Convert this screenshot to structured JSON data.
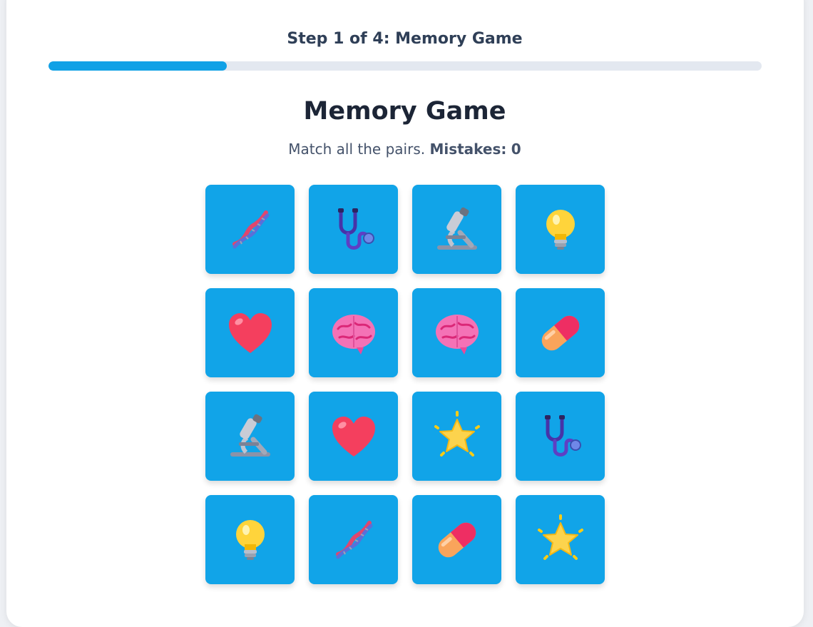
{
  "progress": {
    "label": "Step 1 of 4: Memory Game",
    "fraction": 0.25
  },
  "game": {
    "title": "Memory Game",
    "instruction": "Match all the pairs.",
    "mistakes_label": "Mistakes:",
    "mistakes_value": "0"
  },
  "tiles": [
    "dna-icon",
    "stethoscope-icon",
    "microscope-icon",
    "lightbulb-icon",
    "heart-icon",
    "brain-icon",
    "brain-icon",
    "pill-icon",
    "microscope-icon",
    "heart-icon",
    "star-icon",
    "stethoscope-icon",
    "lightbulb-icon",
    "dna-icon",
    "pill-icon",
    "star-icon"
  ],
  "colors": {
    "accent": "#11a1e6",
    "tile": "#11a4e8",
    "track": "#e3e8f0"
  }
}
